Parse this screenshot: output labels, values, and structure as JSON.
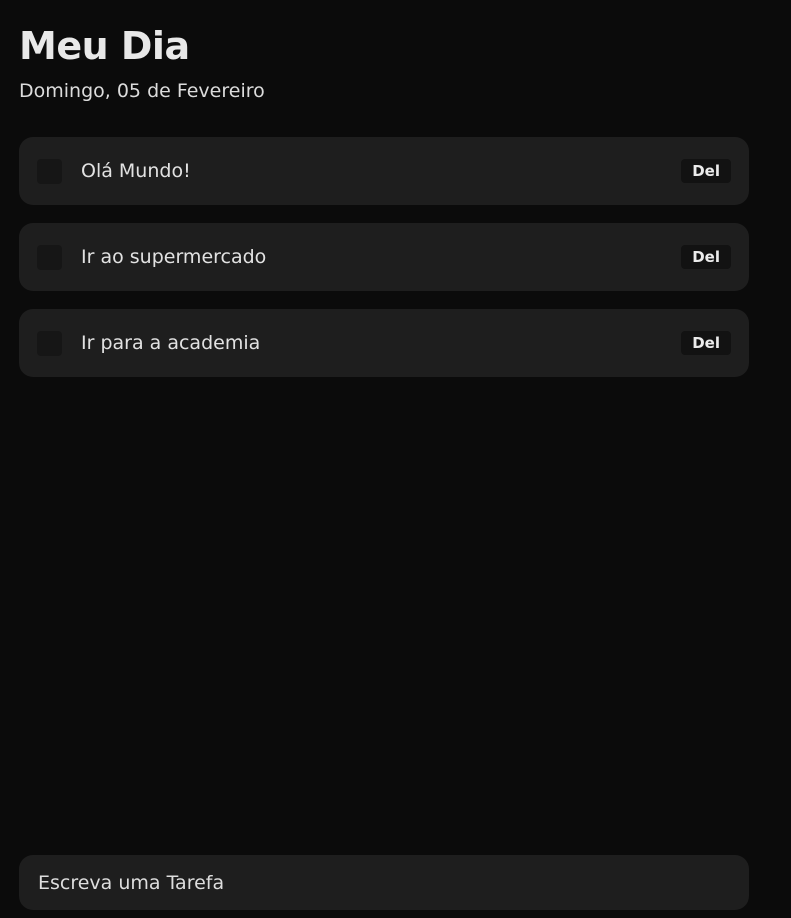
{
  "header": {
    "title": "Meu Dia",
    "date": "Domingo, 05 de Fevereiro"
  },
  "tasks": [
    {
      "label": "Olá Mundo!",
      "done": false,
      "delete_label": "Del"
    },
    {
      "label": "Ir ao supermercado",
      "done": false,
      "delete_label": "Del"
    },
    {
      "label": "Ir para a academia",
      "done": false,
      "delete_label": "Del"
    }
  ],
  "new_task": {
    "placeholder": "Escreva uma Tarefa",
    "value": ""
  },
  "colors": {
    "background": "#0b0b0b",
    "card": "#1e1e1e",
    "checkbox": "#161616",
    "text": "#e2e2e2"
  }
}
